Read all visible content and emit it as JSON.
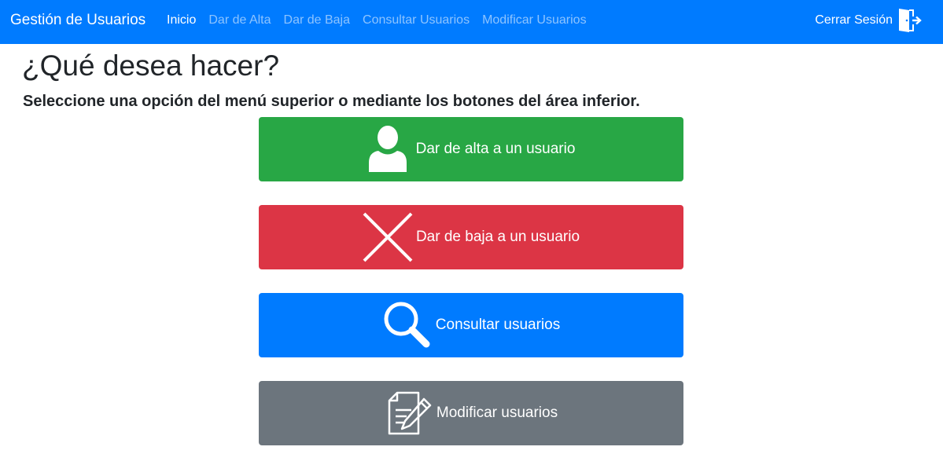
{
  "navbar": {
    "brand": "Gestión de Usuarios",
    "links": [
      {
        "label": "Inicio",
        "active": true
      },
      {
        "label": "Dar de Alta",
        "active": false
      },
      {
        "label": "Dar de Baja",
        "active": false
      },
      {
        "label": "Consultar Usuarios",
        "active": false
      },
      {
        "label": "Modificar Usuarios",
        "active": false
      }
    ],
    "logout_label": "Cerrar Sesión",
    "logout_icon": "door-exit-icon"
  },
  "main": {
    "title": "¿Qué desea hacer?",
    "subtitle": "Seleccione una opción del menú superior o mediante los botones del área inferior.",
    "actions": [
      {
        "label": "Dar de alta a un usuario",
        "icon": "user-icon",
        "color": "#28a745"
      },
      {
        "label": "Dar de baja a un usuario",
        "icon": "x-icon",
        "color": "#dc3545"
      },
      {
        "label": "Consultar usuarios",
        "icon": "search-icon",
        "color": "#007bff"
      },
      {
        "label": "Modificar usuarios",
        "icon": "edit-document-icon",
        "color": "#6c757d"
      }
    ]
  },
  "colors": {
    "navbar": "#007bff",
    "text": "#212529"
  }
}
